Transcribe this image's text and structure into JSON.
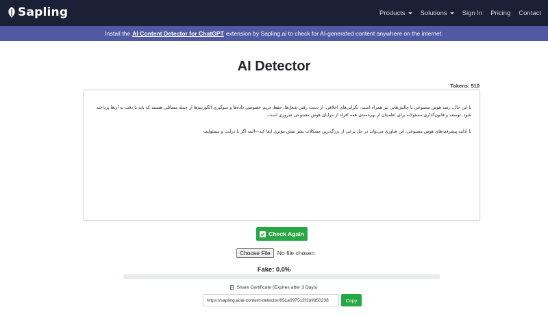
{
  "navbar": {
    "brand": "Sapling",
    "items": [
      {
        "label": "Products",
        "dropdown": true
      },
      {
        "label": "Solutions",
        "dropdown": true
      },
      {
        "label": "Sign In",
        "dropdown": false
      },
      {
        "label": "Pricing",
        "dropdown": false
      },
      {
        "label": "Contact",
        "dropdown": false
      }
    ]
  },
  "promo": {
    "prefix": "Install the",
    "link": "AI Content Detector for ChatGPT",
    "suffix": "extension by Sapling.ai to check for AI-generated content anywhere on the internet."
  },
  "main": {
    "title": "AI Detector",
    "tokens_label": "Tokens:",
    "tokens_value": "510",
    "editor_paragraphs": [
      "با این حال، رشد هوش مصنوعی با چالش‌هایی نیز همراه است. نگرانی‌های اخلاقی، از دست رفتن شغل‌ها، حفظ حریم خصوصی داده‌ها و سوگیری الگوریتم‌ها از جمله مسائلی هستند که باید با دقت به آن‌ها پرداخته شود. توسعه و قانون‌گذاری مسئولانه برای اطمینان از بهره‌مندی همه افراد از مزایای هوش مصنوعی ضروری است.",
      "با ادامه پیشرفت‌های هوش مصنوعی، این فناوری می‌تواند در حل برخی از بزرگ‌ترین مشکلات بشر نقش مؤثری ایفا کند—البته اگر با درایت و مسئولیت"
    ],
    "check_button": "Check Again",
    "file_button": "Choose File",
    "file_status": "No file chosen",
    "fake_label": "Fake: 0.0%",
    "fake_fraction": 0.0,
    "share_label": "Share Certificate (Expires after 3 Days)",
    "share_url": "https://sapling.ai/ai-content-detector/851a097512f1b9950238",
    "copy_button": "Copy"
  },
  "colors": {
    "navbar": "#1a2035",
    "promo": "#4f5aa2",
    "check_button": "#28a745",
    "progress_track": "#e9ecef"
  },
  "icons": [
    "sapling-logo-icon",
    "check-icon",
    "certificate-icon",
    "caret-down-icon"
  ]
}
